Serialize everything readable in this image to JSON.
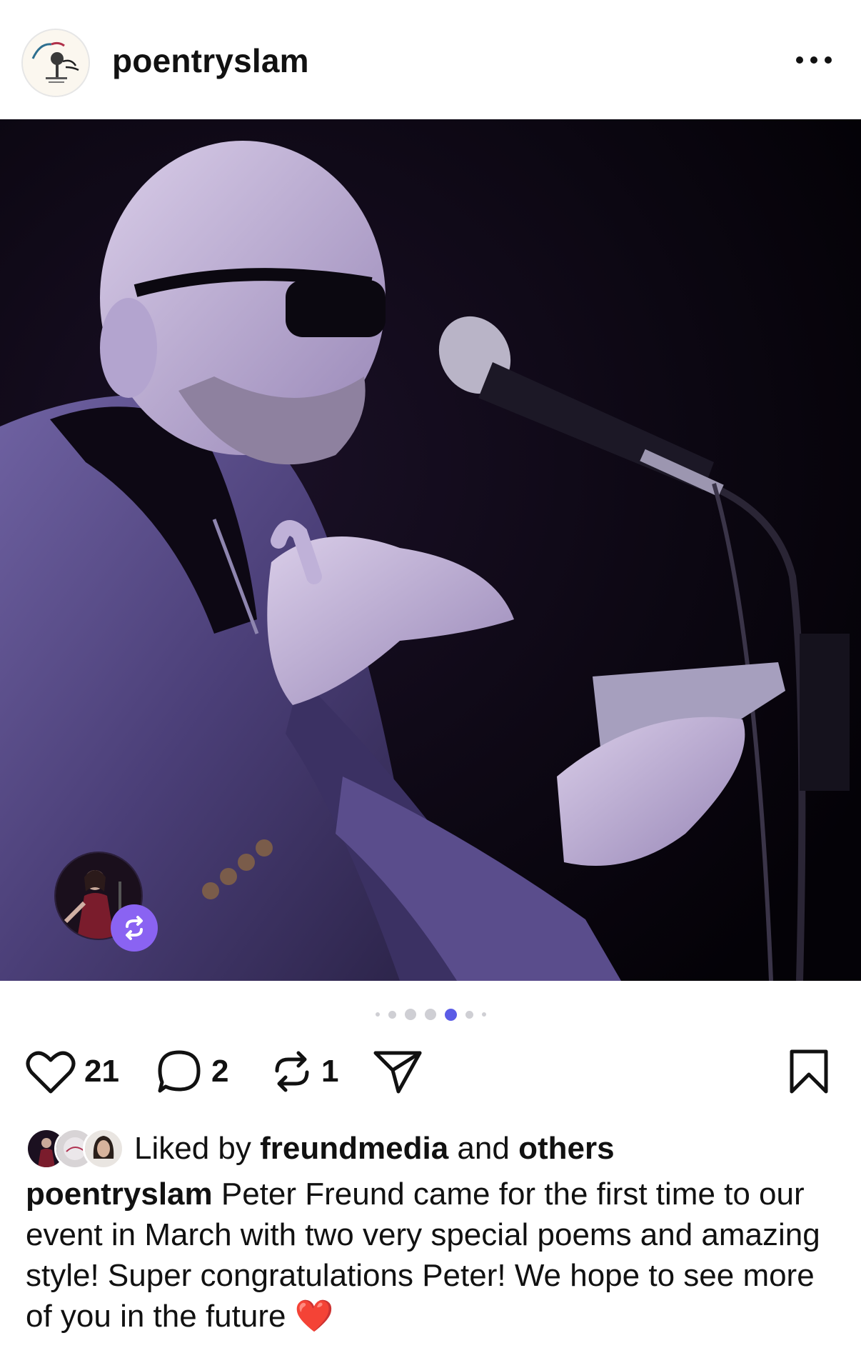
{
  "post": {
    "username": "poentryslam",
    "avatar_icon": "poetry-slam-logo",
    "more_icon": "more-horizontal-icon"
  },
  "carousel": {
    "dot_count": 7,
    "active_index": 4
  },
  "actions": {
    "likes": "21",
    "comments": "2",
    "reposts": "1"
  },
  "liked_by": {
    "prefix": "Liked by",
    "user": "freundmedia",
    "joiner": "and",
    "suffix": "others"
  },
  "caption": {
    "username": "poentryslam",
    "text": "Peter Freund came for the first time to our event in March with two very special poems and amazing style! Super congratulations Peter! We hope to see more of you in the future",
    "emoji": "❤️"
  },
  "colors": {
    "accent": "#8a63f2",
    "pager_active": "#5b5ce6",
    "photo_tint": "#6b5a9a"
  }
}
